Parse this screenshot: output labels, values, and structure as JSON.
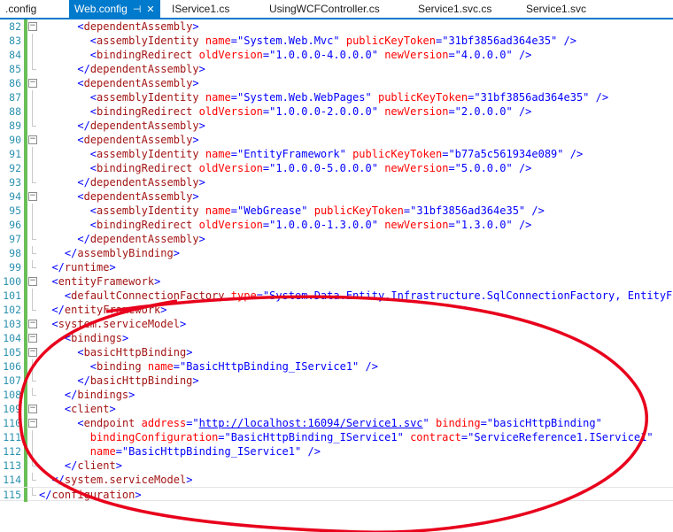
{
  "tabs": [
    {
      "label": ".config",
      "active": false
    },
    {
      "label": "Web.config",
      "active": true,
      "pin": "⊣",
      "close": "✕"
    },
    {
      "label": "IService1.cs",
      "active": false
    },
    {
      "label": "UsingWCFController.cs",
      "active": false
    },
    {
      "label": "Service1.svc.cs",
      "active": false
    },
    {
      "label": "Service1.svc",
      "active": false
    }
  ],
  "lines": [
    {
      "n": "82",
      "indent": "      ",
      "tokens": [
        [
          "d",
          "<"
        ],
        [
          "t",
          "dependentAssembly"
        ],
        [
          "d",
          ">"
        ]
      ],
      "fold": true
    },
    {
      "n": "83",
      "indent": "        ",
      "tokens": [
        [
          "d",
          "<"
        ],
        [
          "t",
          "assemblyIdentity"
        ],
        [
          "s",
          " "
        ],
        [
          "a",
          "name"
        ],
        [
          "d",
          "=\""
        ],
        [
          "v",
          "System.Web.Mvc"
        ],
        [
          "d",
          "\""
        ],
        [
          "s",
          " "
        ],
        [
          "a",
          "publicKeyToken"
        ],
        [
          "d",
          "=\""
        ],
        [
          "v",
          "31bf3856ad364e35"
        ],
        [
          "d",
          "\""
        ],
        [
          "s",
          " "
        ],
        [
          "d",
          "/>"
        ]
      ]
    },
    {
      "n": "84",
      "indent": "        ",
      "tokens": [
        [
          "d",
          "<"
        ],
        [
          "t",
          "bindingRedirect"
        ],
        [
          "s",
          " "
        ],
        [
          "a",
          "oldVersion"
        ],
        [
          "d",
          "=\""
        ],
        [
          "v",
          "1.0.0.0-4.0.0.0"
        ],
        [
          "d",
          "\""
        ],
        [
          "s",
          " "
        ],
        [
          "a",
          "newVersion"
        ],
        [
          "d",
          "=\""
        ],
        [
          "v",
          "4.0.0.0"
        ],
        [
          "d",
          "\""
        ],
        [
          "s",
          " "
        ],
        [
          "d",
          "/>"
        ]
      ]
    },
    {
      "n": "85",
      "indent": "      ",
      "tokens": [
        [
          "d",
          "</"
        ],
        [
          "t",
          "dependentAssembly"
        ],
        [
          "d",
          ">"
        ]
      ],
      "end": true
    },
    {
      "n": "86",
      "indent": "      ",
      "tokens": [
        [
          "d",
          "<"
        ],
        [
          "t",
          "dependentAssembly"
        ],
        [
          "d",
          ">"
        ]
      ],
      "fold": true
    },
    {
      "n": "87",
      "indent": "        ",
      "tokens": [
        [
          "d",
          "<"
        ],
        [
          "t",
          "assemblyIdentity"
        ],
        [
          "s",
          " "
        ],
        [
          "a",
          "name"
        ],
        [
          "d",
          "=\""
        ],
        [
          "v",
          "System.Web.WebPages"
        ],
        [
          "d",
          "\""
        ],
        [
          "s",
          " "
        ],
        [
          "a",
          "publicKeyToken"
        ],
        [
          "d",
          "=\""
        ],
        [
          "v",
          "31bf3856ad364e35"
        ],
        [
          "d",
          "\""
        ],
        [
          "s",
          " "
        ],
        [
          "d",
          "/>"
        ]
      ]
    },
    {
      "n": "88",
      "indent": "        ",
      "tokens": [
        [
          "d",
          "<"
        ],
        [
          "t",
          "bindingRedirect"
        ],
        [
          "s",
          " "
        ],
        [
          "a",
          "oldVersion"
        ],
        [
          "d",
          "=\""
        ],
        [
          "v",
          "1.0.0.0-2.0.0.0"
        ],
        [
          "d",
          "\""
        ],
        [
          "s",
          " "
        ],
        [
          "a",
          "newVersion"
        ],
        [
          "d",
          "=\""
        ],
        [
          "v",
          "2.0.0.0"
        ],
        [
          "d",
          "\""
        ],
        [
          "s",
          " "
        ],
        [
          "d",
          "/>"
        ]
      ]
    },
    {
      "n": "89",
      "indent": "      ",
      "tokens": [
        [
          "d",
          "</"
        ],
        [
          "t",
          "dependentAssembly"
        ],
        [
          "d",
          ">"
        ]
      ],
      "end": true
    },
    {
      "n": "90",
      "indent": "      ",
      "tokens": [
        [
          "d",
          "<"
        ],
        [
          "t",
          "dependentAssembly"
        ],
        [
          "d",
          ">"
        ]
      ],
      "fold": true
    },
    {
      "n": "91",
      "indent": "        ",
      "tokens": [
        [
          "d",
          "<"
        ],
        [
          "t",
          "assemblyIdentity"
        ],
        [
          "s",
          " "
        ],
        [
          "a",
          "name"
        ],
        [
          "d",
          "=\""
        ],
        [
          "v",
          "EntityFramework"
        ],
        [
          "d",
          "\""
        ],
        [
          "s",
          " "
        ],
        [
          "a",
          "publicKeyToken"
        ],
        [
          "d",
          "=\""
        ],
        [
          "v",
          "b77a5c561934e089"
        ],
        [
          "d",
          "\""
        ],
        [
          "s",
          " "
        ],
        [
          "d",
          "/>"
        ]
      ]
    },
    {
      "n": "92",
      "indent": "        ",
      "tokens": [
        [
          "d",
          "<"
        ],
        [
          "t",
          "bindingRedirect"
        ],
        [
          "s",
          " "
        ],
        [
          "a",
          "oldVersion"
        ],
        [
          "d",
          "=\""
        ],
        [
          "v",
          "1.0.0.0-5.0.0.0"
        ],
        [
          "d",
          "\""
        ],
        [
          "s",
          " "
        ],
        [
          "a",
          "newVersion"
        ],
        [
          "d",
          "=\""
        ],
        [
          "v",
          "5.0.0.0"
        ],
        [
          "d",
          "\""
        ],
        [
          "s",
          " "
        ],
        [
          "d",
          "/>"
        ]
      ]
    },
    {
      "n": "93",
      "indent": "      ",
      "tokens": [
        [
          "d",
          "</"
        ],
        [
          "t",
          "dependentAssembly"
        ],
        [
          "d",
          ">"
        ]
      ],
      "end": true
    },
    {
      "n": "94",
      "indent": "      ",
      "tokens": [
        [
          "d",
          "<"
        ],
        [
          "t",
          "dependentAssembly"
        ],
        [
          "d",
          ">"
        ]
      ],
      "fold": true
    },
    {
      "n": "95",
      "indent": "        ",
      "tokens": [
        [
          "d",
          "<"
        ],
        [
          "t",
          "assemblyIdentity"
        ],
        [
          "s",
          " "
        ],
        [
          "a",
          "name"
        ],
        [
          "d",
          "=\""
        ],
        [
          "v",
          "WebGrease"
        ],
        [
          "d",
          "\""
        ],
        [
          "s",
          " "
        ],
        [
          "a",
          "publicKeyToken"
        ],
        [
          "d",
          "=\""
        ],
        [
          "v",
          "31bf3856ad364e35"
        ],
        [
          "d",
          "\""
        ],
        [
          "s",
          " "
        ],
        [
          "d",
          "/>"
        ]
      ]
    },
    {
      "n": "96",
      "indent": "        ",
      "tokens": [
        [
          "d",
          "<"
        ],
        [
          "t",
          "bindingRedirect"
        ],
        [
          "s",
          " "
        ],
        [
          "a",
          "oldVersion"
        ],
        [
          "d",
          "=\""
        ],
        [
          "v",
          "1.0.0.0-1.3.0.0"
        ],
        [
          "d",
          "\""
        ],
        [
          "s",
          " "
        ],
        [
          "a",
          "newVersion"
        ],
        [
          "d",
          "=\""
        ],
        [
          "v",
          "1.3.0.0"
        ],
        [
          "d",
          "\""
        ],
        [
          "s",
          " "
        ],
        [
          "d",
          "/>"
        ]
      ]
    },
    {
      "n": "97",
      "indent": "      ",
      "tokens": [
        [
          "d",
          "</"
        ],
        [
          "t",
          "dependentAssembly"
        ],
        [
          "d",
          ">"
        ]
      ],
      "end": true
    },
    {
      "n": "98",
      "indent": "    ",
      "tokens": [
        [
          "d",
          "</"
        ],
        [
          "t",
          "assemblyBinding"
        ],
        [
          "d",
          ">"
        ]
      ],
      "end": true
    },
    {
      "n": "99",
      "indent": "  ",
      "tokens": [
        [
          "d",
          "</"
        ],
        [
          "t",
          "runtime"
        ],
        [
          "d",
          ">"
        ]
      ],
      "end": true
    },
    {
      "n": "100",
      "indent": "  ",
      "tokens": [
        [
          "d",
          "<"
        ],
        [
          "t",
          "entityFramework"
        ],
        [
          "d",
          ">"
        ]
      ],
      "fold": true
    },
    {
      "n": "101",
      "indent": "    ",
      "tokens": [
        [
          "d",
          "<"
        ],
        [
          "t",
          "defaultConnectionFactory"
        ],
        [
          "s",
          " "
        ],
        [
          "a",
          "type"
        ],
        [
          "d",
          "=\""
        ],
        [
          "v",
          "System.Data.Entity.Infrastructure.SqlConnectionFactory, EntityFrame"
        ]
      ]
    },
    {
      "n": "102",
      "indent": "  ",
      "tokens": [
        [
          "d",
          "</"
        ],
        [
          "t",
          "entityFramework"
        ],
        [
          "d",
          ">"
        ]
      ],
      "end": true
    },
    {
      "n": "103",
      "indent": "  ",
      "tokens": [
        [
          "d",
          "<"
        ],
        [
          "t",
          "system.serviceModel"
        ],
        [
          "d",
          ">"
        ]
      ],
      "fold": true
    },
    {
      "n": "104",
      "indent": "    ",
      "tokens": [
        [
          "d",
          "<"
        ],
        [
          "t",
          "bindings"
        ],
        [
          "d",
          ">"
        ]
      ],
      "fold": true
    },
    {
      "n": "105",
      "indent": "      ",
      "tokens": [
        [
          "d",
          "<"
        ],
        [
          "t",
          "basicHttpBinding"
        ],
        [
          "d",
          ">"
        ]
      ],
      "fold": true
    },
    {
      "n": "106",
      "indent": "        ",
      "tokens": [
        [
          "d",
          "<"
        ],
        [
          "t",
          "binding"
        ],
        [
          "s",
          " "
        ],
        [
          "a",
          "name"
        ],
        [
          "d",
          "=\""
        ],
        [
          "v",
          "BasicHttpBinding_IService1"
        ],
        [
          "d",
          "\""
        ],
        [
          "s",
          " "
        ],
        [
          "d",
          "/>"
        ]
      ]
    },
    {
      "n": "107",
      "indent": "      ",
      "tokens": [
        [
          "d",
          "</"
        ],
        [
          "t",
          "basicHttpBinding"
        ],
        [
          "d",
          ">"
        ]
      ],
      "end": true
    },
    {
      "n": "108",
      "indent": "    ",
      "tokens": [
        [
          "d",
          "</"
        ],
        [
          "t",
          "bindings"
        ],
        [
          "d",
          ">"
        ]
      ],
      "end": true
    },
    {
      "n": "109",
      "indent": "    ",
      "tokens": [
        [
          "d",
          "<"
        ],
        [
          "t",
          "client"
        ],
        [
          "d",
          ">"
        ]
      ],
      "fold": true
    },
    {
      "n": "110",
      "indent": "      ",
      "tokens": [
        [
          "d",
          "<"
        ],
        [
          "t",
          "endpoint"
        ],
        [
          "s",
          " "
        ],
        [
          "a",
          "address"
        ],
        [
          "d",
          "=\""
        ],
        [
          "u",
          "http://localhost:16094/Service1.svc"
        ],
        [
          "d",
          "\""
        ],
        [
          "s",
          " "
        ],
        [
          "a",
          "binding"
        ],
        [
          "d",
          "=\""
        ],
        [
          "v",
          "basicHttpBinding"
        ],
        [
          "d",
          "\""
        ]
      ],
      "fold": true
    },
    {
      "n": "111",
      "indent": "        ",
      "tokens": [
        [
          "a",
          "bindingConfiguration"
        ],
        [
          "d",
          "=\""
        ],
        [
          "v",
          "BasicHttpBinding_IService1"
        ],
        [
          "d",
          "\""
        ],
        [
          "s",
          " "
        ],
        [
          "a",
          "contract"
        ],
        [
          "d",
          "=\""
        ],
        [
          "v",
          "ServiceReference1.IService1"
        ],
        [
          "d",
          "\""
        ]
      ]
    },
    {
      "n": "112",
      "indent": "        ",
      "tokens": [
        [
          "a",
          "name"
        ],
        [
          "d",
          "=\""
        ],
        [
          "v",
          "BasicHttpBinding_IService1"
        ],
        [
          "d",
          "\""
        ],
        [
          "s",
          " "
        ],
        [
          "d",
          "/>"
        ]
      ]
    },
    {
      "n": "113",
      "indent": "    ",
      "tokens": [
        [
          "d",
          "</"
        ],
        [
          "t",
          "client"
        ],
        [
          "d",
          ">"
        ]
      ],
      "end": true
    },
    {
      "n": "114",
      "indent": "  ",
      "tokens": [
        [
          "d",
          "</"
        ],
        [
          "t",
          "system.serviceModel"
        ],
        [
          "d",
          ">"
        ]
      ],
      "end": true
    },
    {
      "n": "115",
      "indent": "",
      "tokens": [
        [
          "d",
          "</"
        ],
        [
          "t",
          "configuration"
        ],
        [
          "d",
          ">"
        ]
      ],
      "end": true
    }
  ],
  "annotation_color": "#e8001c"
}
